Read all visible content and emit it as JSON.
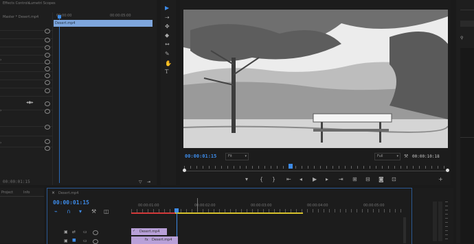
{
  "effect_controls": {
    "tabs": [
      "Effects Controls",
      "Lumetri Scopes"
    ],
    "source_label": "Master * Desert.mp4",
    "clip_label": "Desert.mp4",
    "ruler_times": [
      "00:00:00",
      "00:00:05:00"
    ],
    "bottom_timecode": "00:00:01:15"
  },
  "tools": {
    "icons": [
      "selection-tool-icon",
      "track-select-icon",
      "ripple-edit-icon",
      "razor-icon",
      "slip-icon",
      "pen-icon",
      "hand-icon",
      "type-icon"
    ]
  },
  "program": {
    "timecode": "00:00:01:15",
    "zoom": "Fit",
    "quality": "Full",
    "duration": "00:00:10:18",
    "transport": [
      "marker",
      "in",
      "out",
      "go-to-in",
      "step-back",
      "play",
      "step-forward",
      "go-to-out",
      "insert",
      "overwrite",
      "export-frame",
      "button-editor",
      "add"
    ]
  },
  "project": {
    "tabs": [
      "Project",
      "Info"
    ]
  },
  "timeline": {
    "sequence": "Desert.mp4",
    "timecode": "00:00:01:15",
    "ruler_times": [
      "00:00:01:00",
      "00:00:02:00",
      "00:00:03:00",
      "00:00:04:00",
      "00:00:05:00"
    ],
    "clips": [
      "Desert.mp4",
      "Desert.mp4"
    ]
  },
  "colors": {
    "accent": "#3d8be8",
    "clip_blue": "#7ea6dd",
    "clip_violet": "#b8a0d8",
    "ruler_red": "#d43a3a",
    "ruler_yellow": "#d8c22c"
  }
}
